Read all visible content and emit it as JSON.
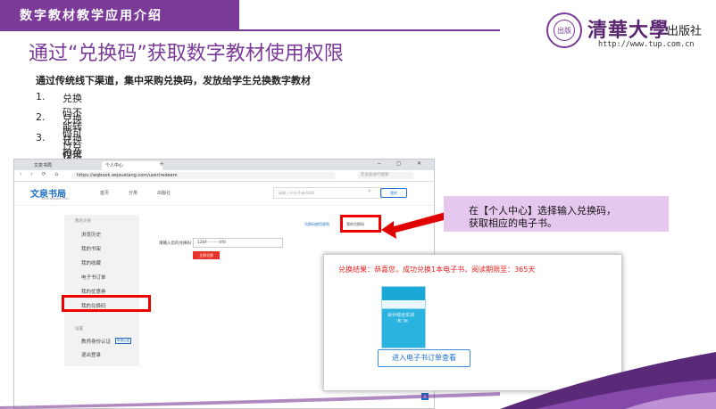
{
  "header": {
    "section_label": "数字教材教学应用介绍",
    "logo": {
      "seal_text": "TSINGHUA UNIVERSITY PRESS",
      "seal_center": "出版",
      "name": "清華大學",
      "publisher": "出版社",
      "url": "http://www.tup.com.cn"
    }
  },
  "page_title": "通过“兑换码”获取数字教材使用权限",
  "subtitle": "通过传统线下渠道，集中采购兑换码，发放给学生兑换数字教材",
  "points": [
    {
      "num": "1.",
      "text": "兑换码不能转让，仅供领取用户使用；"
    },
    {
      "num": "2.",
      "text": "兑换码可以兑换一本或多本数字教材；"
    },
    {
      "num": "3.",
      "text": "兑换码兑换的数字教材可以设置阅读期限；"
    }
  ],
  "browser": {
    "tabs": [
      "文泉书局",
      "个人中心"
    ],
    "tab_plus": "+",
    "window_controls": "⎯ ◻ ✕",
    "nav_buttons": "‹ › ⟳ ⌂",
    "url": "https://wqbook.wqxuetang.com/user/redeem",
    "url_search": "在此处进行搜索",
    "site": {
      "logo": "文泉书局",
      "logo_sub": "www.wqbook.com",
      "nav": [
        "首页",
        "分类",
        "出版社"
      ],
      "search_placeholder": "请输入书名/作者/ISBN",
      "login": "我的"
    },
    "left_panel": {
      "section1": "我的文泉",
      "items": [
        "浏览历史",
        "我的书架",
        "我的收藏",
        "电子书订单",
        "我的优惠券",
        "我的兑换码"
      ],
      "section2": "设置",
      "items2": [
        "教师身份认证",
        "退出登录"
      ],
      "badge": "申请认证"
    },
    "main": {
      "link1": "兑换码使用规则",
      "link2": "我的兑换码",
      "redeem_label": "请输入您的兑换码:",
      "redeem_value": "12bf··········hfd",
      "redeem_button": "立即兑换",
      "scroll_top": "▲"
    }
  },
  "callout": {
    "line1": "在【个人中心】选择输入兑换码，",
    "line2": "获取相应的电子书。"
  },
  "popup": {
    "result": "兑换结果：恭喜您，成功兑换1本电子书，阅读期限至：365天",
    "book_title": "会计综合实训",
    "book_sub": "（第二版）",
    "button": "进入电子书订单查看"
  },
  "colors": {
    "brand_purple": "#7b3a97",
    "highlight_red": "#e00000",
    "callout_bg": "#e6c8ef",
    "link_blue": "#1d6fc4"
  }
}
